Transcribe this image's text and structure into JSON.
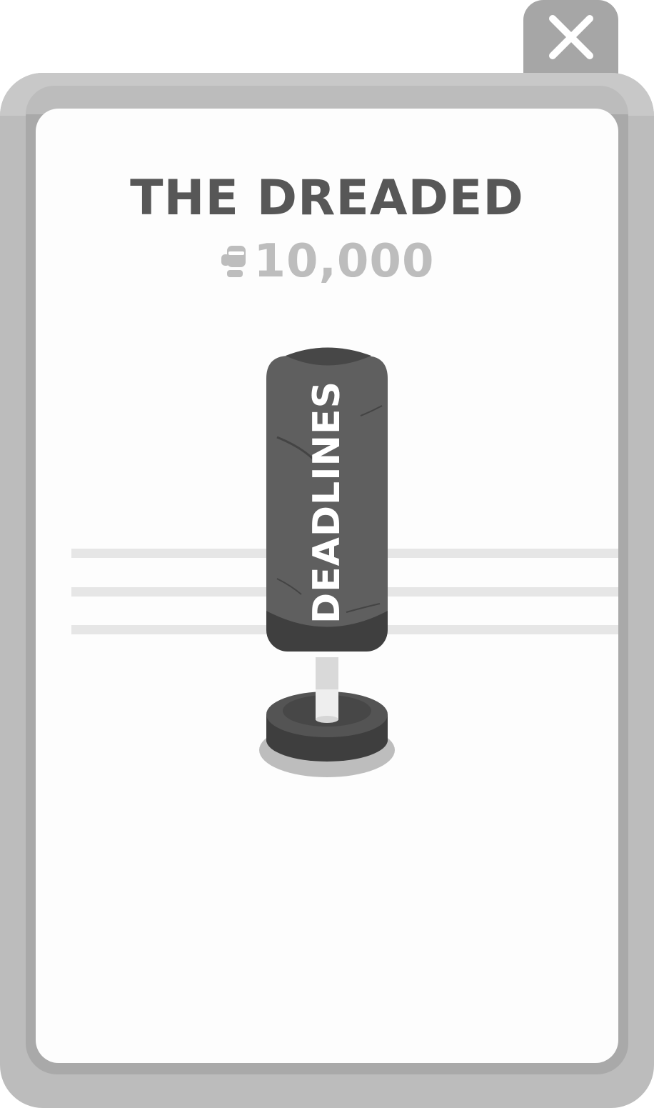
{
  "header": {
    "close_icon": "close-icon"
  },
  "item": {
    "title": "THE DREADED",
    "price": "10,000",
    "currency_icon": "glove-coin-icon",
    "bag_label": "DEADLINES"
  },
  "colors": {
    "frame": "#bcbcbc",
    "frame_shadow": "#a9a9a9",
    "card": "#fdfdfd",
    "title": "#575757",
    "price": "#bdbdbd",
    "bag": "#5f5f5f",
    "bag_dark": "#3f3f3f",
    "rope": "#e6e6e6"
  }
}
